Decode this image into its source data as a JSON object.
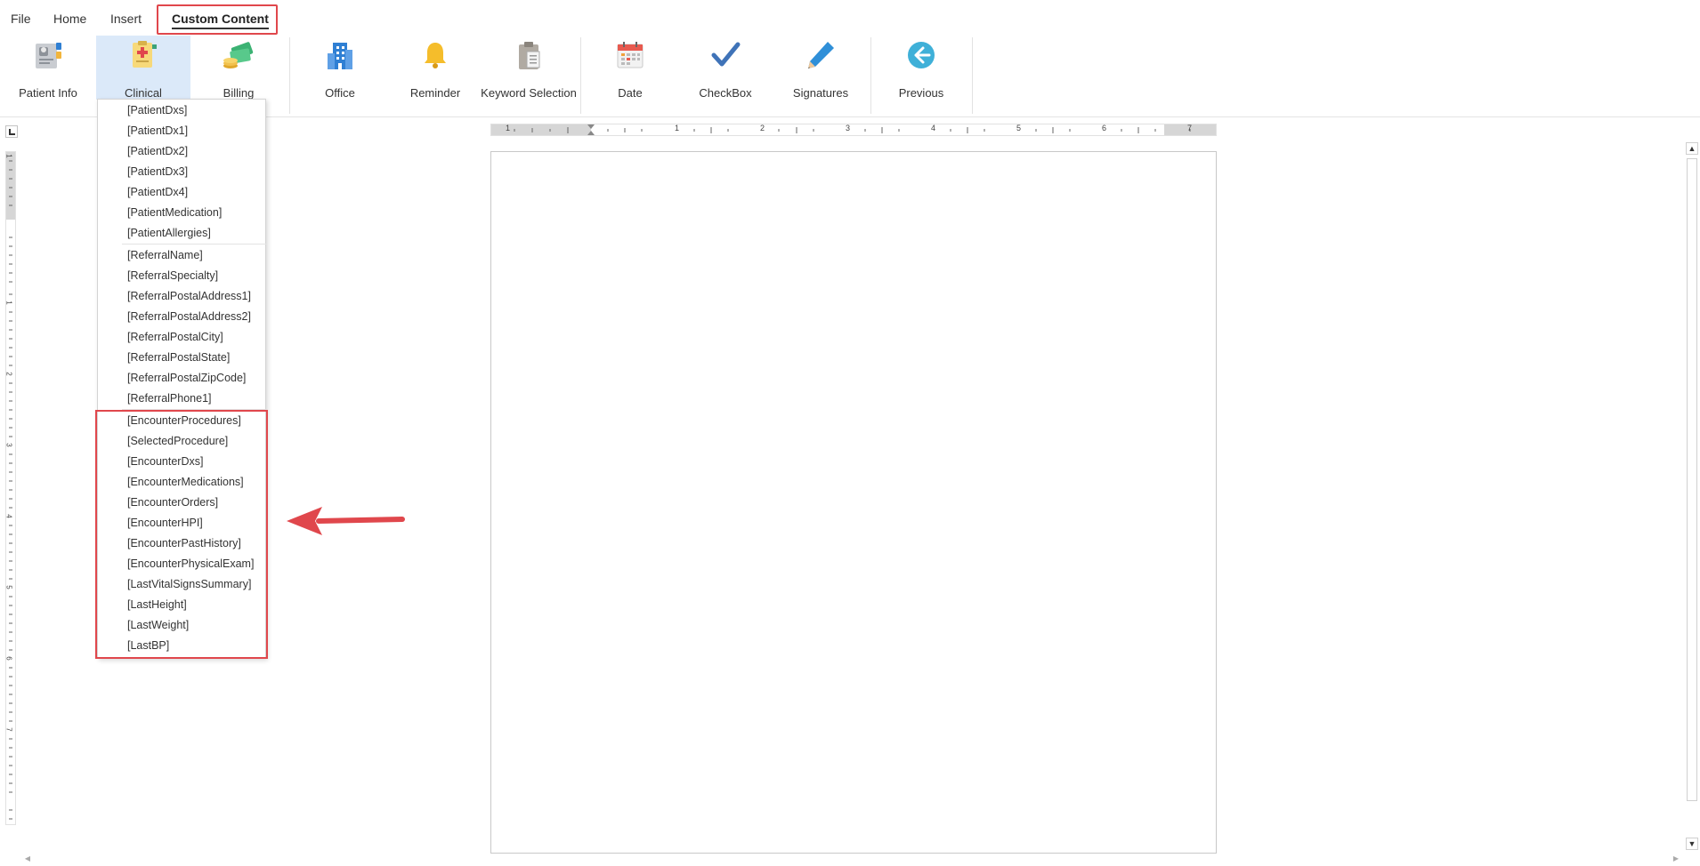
{
  "tabs": [
    {
      "label": "File"
    },
    {
      "label": "Home"
    },
    {
      "label": "Insert"
    },
    {
      "label": "Custom Content"
    }
  ],
  "ribbon": {
    "buttons": [
      {
        "label": "Patient Info",
        "icon": "patient-info-icon"
      },
      {
        "label": "Clinical",
        "icon": "clinical-icon"
      },
      {
        "label": "Billing",
        "icon": "billing-icon"
      },
      {
        "label": "Office",
        "icon": "office-building-icon"
      },
      {
        "label": "Reminder",
        "icon": "bell-icon"
      },
      {
        "label": "Keyword Selection",
        "icon": "clipboard-icon"
      },
      {
        "label": "Date",
        "icon": "calendar-icon"
      },
      {
        "label": "CheckBox",
        "icon": "checkmark-icon"
      },
      {
        "label": "Signatures",
        "icon": "pen-icon"
      },
      {
        "label": "Previous",
        "icon": "back-arrow-icon"
      }
    ],
    "selected": "Clinical"
  },
  "clinical_menu": {
    "patient_items": [
      "[PatientDxs]",
      "[PatientDx1]",
      "[PatientDx2]",
      "[PatientDx3]",
      "[PatientDx4]",
      "[PatientMedication]",
      "[PatientAllergies]"
    ],
    "referral_items": [
      "[ReferralName]",
      "[ReferralSpecialty]",
      "[ReferralPostalAddress1]",
      "[ReferralPostalAddress2]",
      "[ReferralPostalCity]",
      "[ReferralPostalState]",
      "[ReferralPostalZipCode]",
      "[ReferralPhone1]"
    ],
    "encounter_items": [
      "[EncounterProcedures]",
      "[SelectedProcedure]",
      "[EncounterDxs]",
      "[EncounterMedications]",
      "[EncounterOrders]",
      "[EncounterHPI]",
      "[EncounterPastHistory]",
      "[EncounterPhysicalExam]",
      "[LastVitalSignsSummary]",
      "[LastHeight]",
      "[LastWeight]",
      "[LastBP]"
    ]
  },
  "ruler": {
    "horizontal_labels": [
      "1",
      "1",
      "2",
      "3",
      "4",
      "5",
      "6",
      "7"
    ],
    "vertical_labels": [
      "1",
      "1",
      "2",
      "3",
      "4",
      "5",
      "6",
      "7"
    ]
  },
  "colors": {
    "highlight": "#e0474c",
    "selected_bg": "#dbe9f9",
    "accent_blue": "#2f7fd3"
  }
}
